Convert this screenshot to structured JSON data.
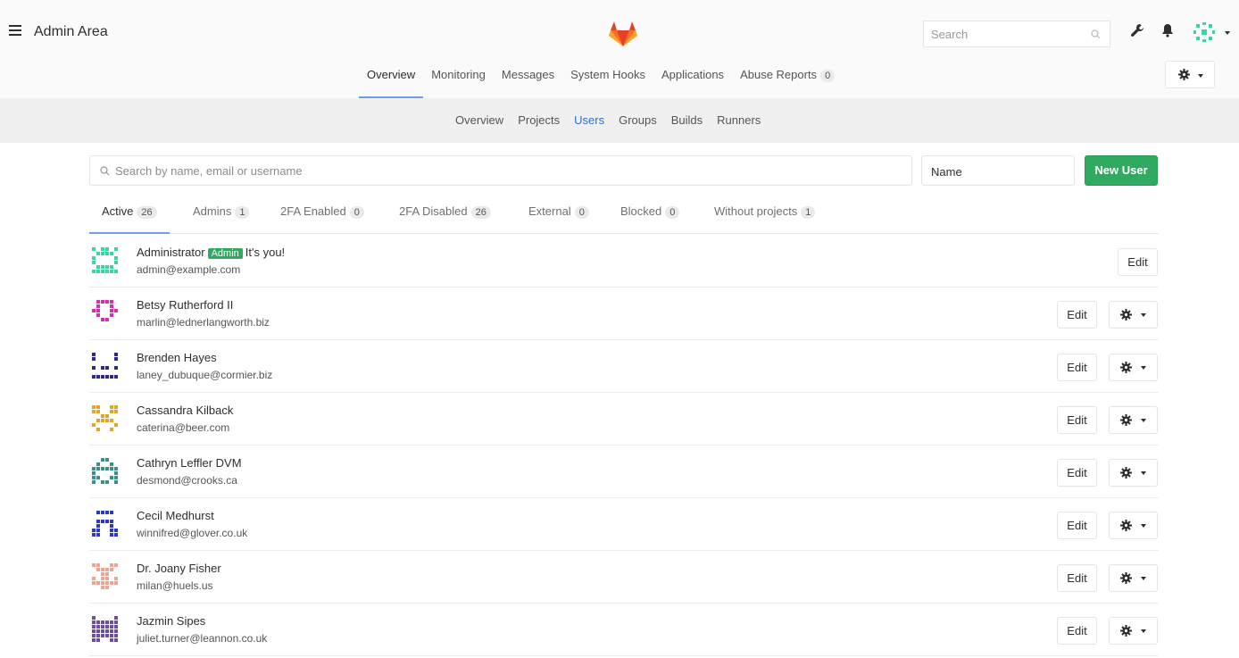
{
  "header": {
    "title": "Admin Area",
    "search_placeholder": "Search",
    "icons": [
      "menu-icon",
      "gitlab-logo",
      "search-icon",
      "wrench-icon",
      "bell-icon",
      "avatar"
    ]
  },
  "top_nav": {
    "tabs": [
      {
        "label": "Overview",
        "active": true
      },
      {
        "label": "Monitoring"
      },
      {
        "label": "Messages"
      },
      {
        "label": "System Hooks"
      },
      {
        "label": "Applications"
      },
      {
        "label": "Abuse Reports",
        "count": "0"
      }
    ]
  },
  "sub_nav": {
    "tabs": [
      {
        "label": "Overview"
      },
      {
        "label": "Projects"
      },
      {
        "label": "Users",
        "active": true
      },
      {
        "label": "Groups"
      },
      {
        "label": "Builds"
      },
      {
        "label": "Runners"
      }
    ]
  },
  "filter": {
    "search_placeholder": "Search by name, email or username",
    "sort_value": "Name",
    "new_user_label": "New User"
  },
  "filter_tabs": [
    {
      "label": "Active",
      "count": "26",
      "active": true
    },
    {
      "label": "Admins",
      "count": "1"
    },
    {
      "label": "2FA Enabled",
      "count": "0"
    },
    {
      "label": "2FA Disabled",
      "count": "26"
    },
    {
      "label": "External",
      "count": "0"
    },
    {
      "label": "Blocked",
      "count": "0"
    },
    {
      "label": "Without projects",
      "count": "1"
    }
  ],
  "users": [
    {
      "name": "Administrator",
      "badge": "Admin",
      "note": "It's you!",
      "email": "admin@example.com",
      "edit": "Edit",
      "color": "#3ad6a0"
    },
    {
      "name": "Betsy Rutherford II",
      "email": "marlin@lednerlangworth.biz",
      "edit": "Edit",
      "color": "#d62fb0"
    },
    {
      "name": "Brenden Hayes",
      "email": "laney_dubuque@cormier.biz",
      "edit": "Edit",
      "color": "#2b2a8a"
    },
    {
      "name": "Cassandra Kilback",
      "email": "caterina@beer.com",
      "edit": "Edit",
      "color": "#e1a52a"
    },
    {
      "name": "Cathryn Leffler DVM",
      "email": "desmond@crooks.ca",
      "edit": "Edit",
      "color": "#3a8f8a"
    },
    {
      "name": "Cecil Medhurst",
      "email": "winnifred@glover.co.uk",
      "edit": "Edit",
      "color": "#2b39c9"
    },
    {
      "name": "Dr. Joany Fisher",
      "email": "milan@huels.us",
      "edit": "Edit",
      "color": "#eaa693"
    },
    {
      "name": "Jazmin Sipes",
      "email": "juliet.turner@leannon.co.uk",
      "edit": "Edit",
      "color": "#6a4fa0"
    }
  ]
}
